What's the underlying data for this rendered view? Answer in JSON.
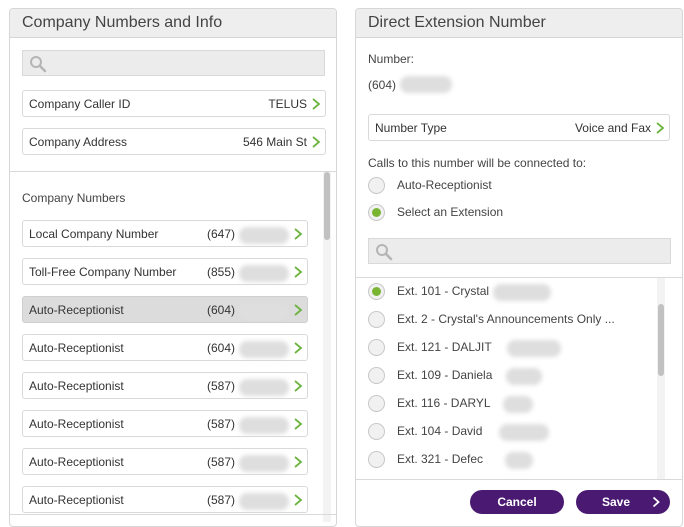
{
  "left": {
    "title": "Company Numbers and Info",
    "search": {
      "placeholder": ""
    },
    "caller_id": {
      "label": "Company Caller ID",
      "value": "TELUS"
    },
    "address": {
      "label": "Company Address",
      "value": "546 Main St"
    },
    "numbers_heading": "Company Numbers",
    "numbers": [
      {
        "label": "Local Company Number",
        "prefix": "(647)"
      },
      {
        "label": "Toll-Free Company Number",
        "prefix": "(855)"
      },
      {
        "label": "Auto-Receptionist",
        "prefix": "(604)",
        "selected": true
      },
      {
        "label": "Auto-Receptionist",
        "prefix": "(604)"
      },
      {
        "label": "Auto-Receptionist",
        "prefix": "(587)"
      },
      {
        "label": "Auto-Receptionist",
        "prefix": "(587)"
      },
      {
        "label": "Auto-Receptionist",
        "prefix": "(587)"
      },
      {
        "label": "Auto-Receptionist",
        "prefix": "(587)"
      }
    ]
  },
  "right": {
    "title": "Direct Extension Number",
    "number_label": "Number:",
    "number_prefix": "(604)",
    "number_type": {
      "label": "Number Type",
      "value": "Voice and Fax"
    },
    "connect_label": "Calls to this number will be connected to:",
    "options": [
      {
        "label": "Auto-Receptionist",
        "checked": false
      },
      {
        "label": "Select an Extension",
        "checked": true
      }
    ],
    "ext_search": {
      "placeholder": ""
    },
    "extensions": [
      {
        "label": "Ext. 101 - Crystal",
        "checked": true
      },
      {
        "label": "Ext. 2 - Crystal's Announcements Only ...",
        "checked": false
      },
      {
        "label": "Ext. 121 - DALJIT",
        "checked": false
      },
      {
        "label": "Ext. 109 - Daniela",
        "checked": false
      },
      {
        "label": "Ext. 116 - DARYL",
        "checked": false
      },
      {
        "label": "Ext. 104 - David",
        "checked": false
      },
      {
        "label": "Ext. 321 - Defec",
        "checked": false
      }
    ],
    "cancel_label": "Cancel",
    "save_label": "Save"
  },
  "colors": {
    "accent": "#4a1a72",
    "check": "#7ab433",
    "chevron": "#6db33f"
  }
}
